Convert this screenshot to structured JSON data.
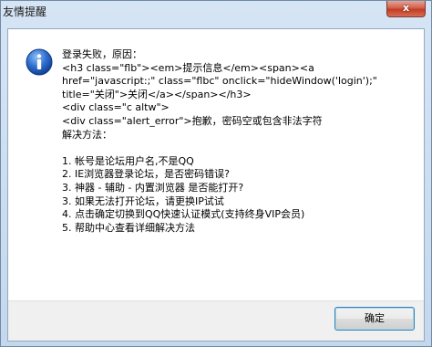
{
  "window": {
    "title": "友情提醒",
    "close_label": "x"
  },
  "icon": {
    "name": "info-icon",
    "color": "#2a5db0"
  },
  "message": {
    "lines": [
      "登录失败，原因：",
      "<h3 class=\"flb\"><em>提示信息</em><span><a",
      "href=\"javascript:;\" class=\"flbc\" onclick=\"hideWindow('login');\"",
      "title=\"关闭\">关闭</a></span></h3>",
      "<div class=\"c altw\">",
      "<div class=\"alert_error\">抱歉，密码空或包含非法字符",
      "解决方法：",
      "",
      "1. 帐号是论坛用户名,不是QQ",
      "2. IE浏览器登录论坛，是否密码错误?",
      "3. 神器 - 辅助 - 内置浏览器 是否能打开?",
      "3. 如果无法打开论坛，请更换IP试试",
      "4. 点击确定切换到QQ快速认证模式(支持终身VIP会员)",
      "5. 帮助中心查看详细解决方法"
    ]
  },
  "footer": {
    "ok_label": "确定"
  }
}
